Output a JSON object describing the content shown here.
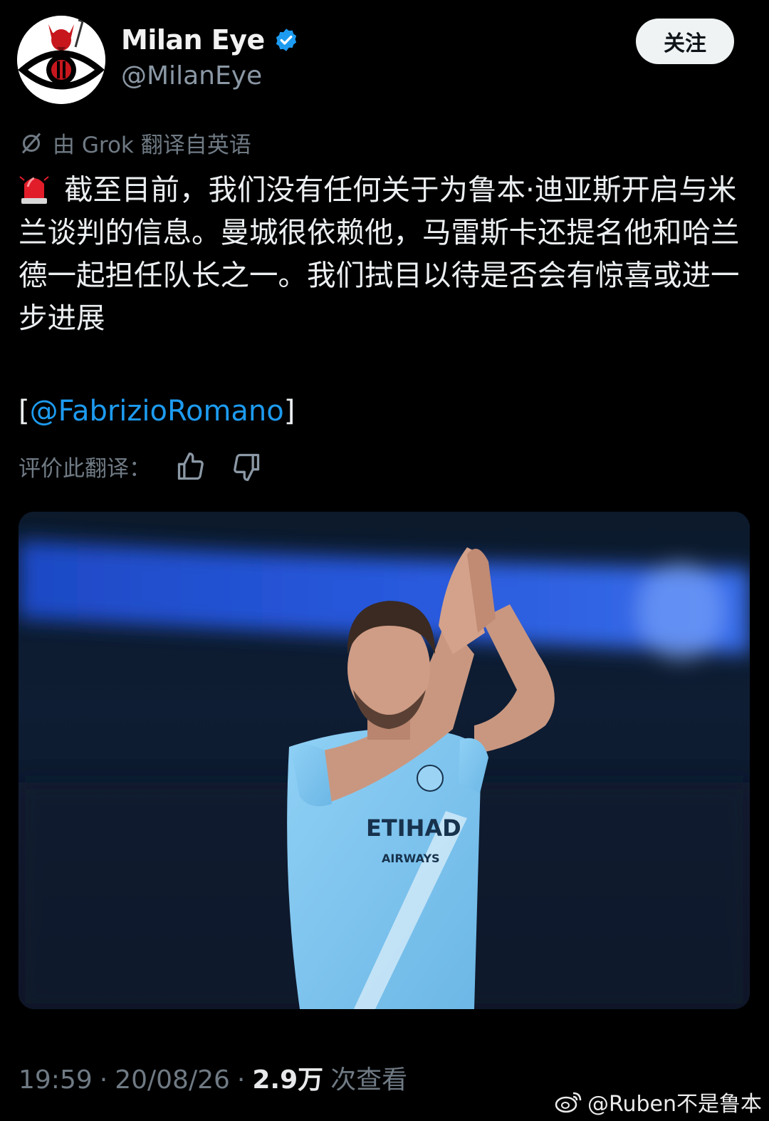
{
  "account": {
    "display_name": "Milan Eye",
    "handle": "@MilanEye",
    "verified": true
  },
  "follow_label": "关注",
  "translation": {
    "note": "由 Grok 翻译自英语",
    "rate_label": "评价此翻译："
  },
  "tweet": {
    "text": "截至目前，我们没有任何关于为鲁本·迪亚斯开启与米兰谈判的信息。曼城很依赖他，马雷斯卡还提名他和哈兰德一起担任队长之一。我们拭目以待是否会有惊喜或进一步进展",
    "mention_open": "[",
    "mention": "@FabrizioRomano",
    "mention_close": "]"
  },
  "meta": {
    "time": "19:59",
    "sep1": "·",
    "date": "20/08/26",
    "sep2": "·",
    "views_count": "2.9万",
    "views_label": "次查看"
  },
  "watermark": "@Ruben不是鲁本",
  "colors": {
    "background": "#000000",
    "link": "#1d9bf0",
    "verified": "#1d9bf0",
    "muted": "#6f7a84",
    "jersey": "#7cc3ee"
  },
  "icons": {
    "verified": "verified-badge-icon",
    "translate": "translate-icon",
    "siren": "siren-emoji",
    "thumbs_up": "thumbs-up-icon",
    "thumbs_down": "thumbs-down-icon",
    "weibo": "weibo-logo-icon"
  }
}
